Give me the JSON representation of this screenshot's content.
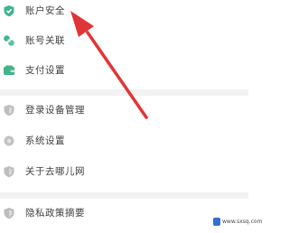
{
  "menu": {
    "items": [
      {
        "label": "账户安全",
        "icon": "shield-check-icon"
      },
      {
        "label": "账号关联",
        "icon": "link-icon"
      },
      {
        "label": "支付设置",
        "icon": "wallet-icon"
      },
      {
        "label": "登录设备管理",
        "icon": "shield-device-icon"
      },
      {
        "label": "系统设置",
        "icon": "gear-icon"
      },
      {
        "label": "关于去哪儿网",
        "icon": "shield-info-icon"
      },
      {
        "label": "隐私政策摘要",
        "icon": "shield-privacy-icon"
      }
    ]
  },
  "watermark": {
    "text": "www.sxsq.com"
  },
  "colors": {
    "accent": "#40b48a",
    "icon_gray": "#b9b9b9",
    "arrow": "#e03537",
    "divider": "#f2f2f2"
  }
}
